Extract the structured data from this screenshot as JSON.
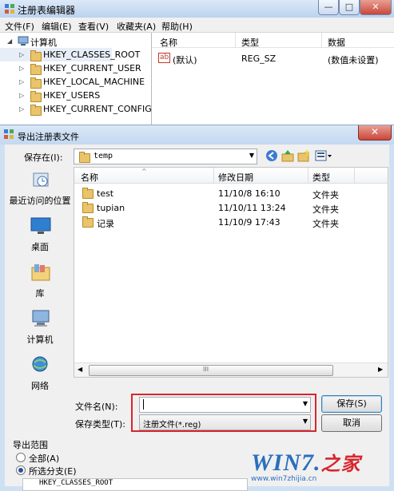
{
  "regedit": {
    "title": "注册表编辑器",
    "window_controls": [
      "—",
      "□",
      "✕"
    ],
    "menu": [
      "文件(F)",
      "编辑(E)",
      "查看(V)",
      "收藏夹(A)",
      "帮助(H)"
    ],
    "tree": {
      "root": "计算机",
      "keys": [
        "HKEY_CLASSES_ROOT",
        "HKEY_CURRENT_USER",
        "HKEY_LOCAL_MACHINE",
        "HKEY_USERS",
        "HKEY_CURRENT_CONFIG"
      ]
    },
    "values_columns": [
      "名称",
      "类型",
      "数据"
    ],
    "values_rows": [
      {
        "icon": "ab",
        "name": "(默认)",
        "type": "REG_SZ",
        "data": "(数值未设置)"
      }
    ]
  },
  "dialog": {
    "title": "导出注册表文件",
    "close_glyph": "✕",
    "save_in_label": "保存在(I):",
    "save_in_value": "temp",
    "places": [
      "最近访问的位置",
      "桌面",
      "库",
      "计算机",
      "网络"
    ],
    "list_columns": [
      "名称",
      "修改日期",
      "类型"
    ],
    "files": [
      {
        "name": "test",
        "date": "11/10/8 16:10",
        "type": "文件夹"
      },
      {
        "name": "tupian",
        "date": "11/10/11 13:24",
        "type": "文件夹"
      },
      {
        "name": "记录",
        "date": "11/10/9 17:43",
        "type": "文件夹"
      }
    ],
    "scroll_glyph": "III",
    "filename_label": "文件名(N):",
    "filename_value": "",
    "filetype_label": "保存类型(T):",
    "filetype_value": "注册文件(*.reg)",
    "save_button": "保存(S)",
    "cancel_button": "取消",
    "export_range": {
      "legend": "导出范围",
      "option_all": "全部(A)",
      "option_selected": "所选分支(E)",
      "selected_option": "option_selected",
      "branch_value": "HKEY_CLASSES_ROOT"
    }
  },
  "watermark": {
    "logo_text": "WIN7.",
    "logo_cjk": "之家",
    "url": "www.win7zhijia.cn"
  },
  "colors": {
    "highlight_border": "#d8262c",
    "folder": "#e9c46a",
    "accent": "#2b6fbd"
  }
}
